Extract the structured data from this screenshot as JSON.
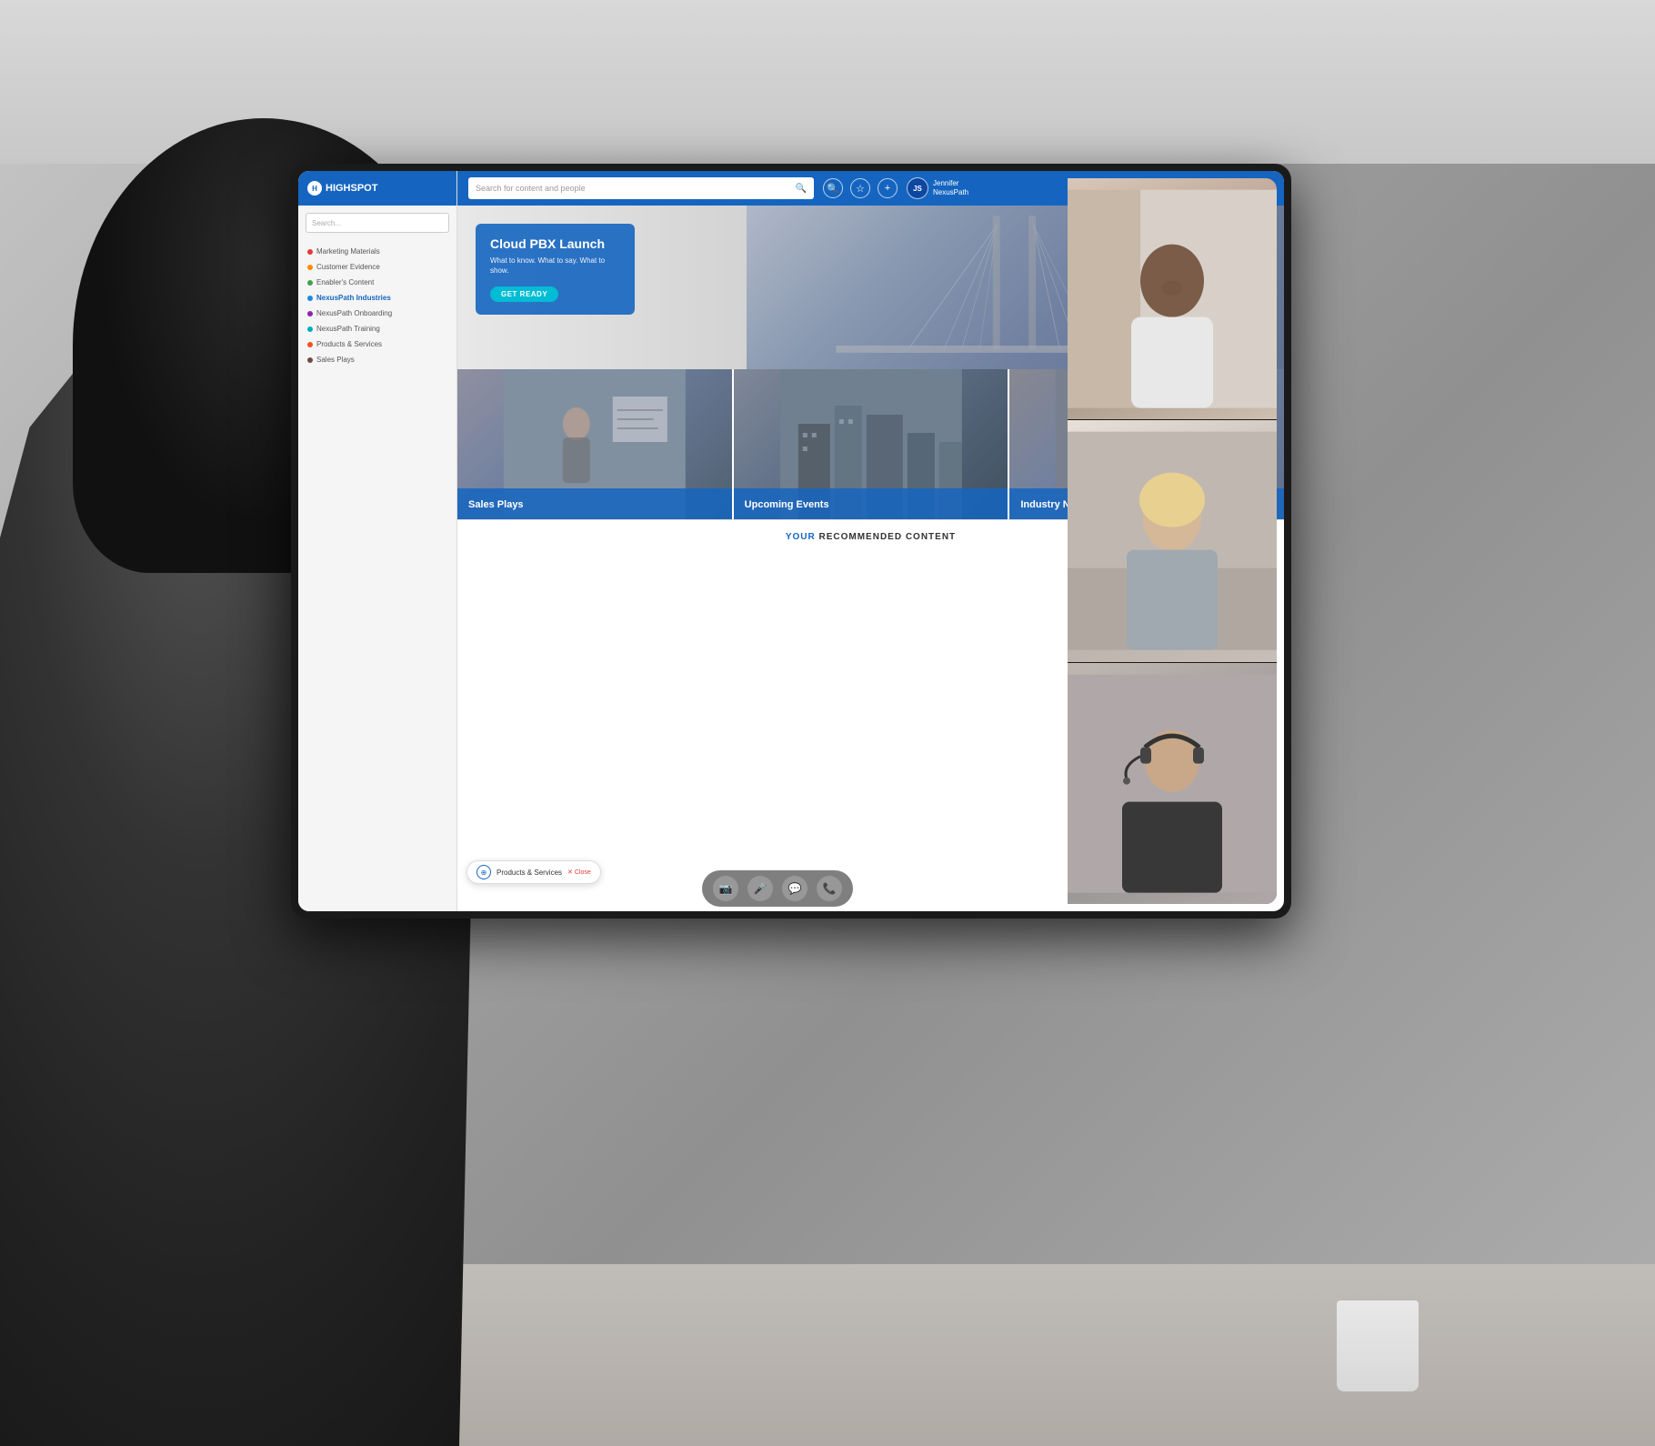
{
  "app": {
    "name": "HIGHSPOT"
  },
  "nav": {
    "search_placeholder": "Search for content and people",
    "user": {
      "initials": "JS",
      "name": "Jennifer",
      "company": "NexusPath"
    },
    "icons": {
      "search": "🔍",
      "star": "☆",
      "plus": "+"
    }
  },
  "sidebar": {
    "items": [
      {
        "label": "Marketing Materials",
        "color": "#e53935"
      },
      {
        "label": "Customer Evidence",
        "color": "#fb8c00"
      },
      {
        "label": "Enabler's Content",
        "color": "#43a047"
      },
      {
        "label": "NexusPath Industries",
        "color": "#1e88e5"
      },
      {
        "label": "NexusPath Onboarding",
        "color": "#8e24aa"
      },
      {
        "label": "NexusPath Training",
        "color": "#00acc1"
      },
      {
        "label": "Products & Services",
        "color": "#f4511e"
      },
      {
        "label": "Sales Plays",
        "color": "#6d4c41"
      }
    ]
  },
  "hero": {
    "title": "Cloud PBX Launch",
    "subtitle": "What to know. What to say. What to show.",
    "cta_label": "GET READY"
  },
  "cards": [
    {
      "label": "Sales Plays",
      "bg": "sales"
    },
    {
      "label": "Upcoming Events",
      "bg": "events"
    },
    {
      "label": "Industry News",
      "bg": "news"
    }
  ],
  "recommended": {
    "prefix": "YOUR",
    "text": " RECOMMENDED CONTENT"
  },
  "tooltip": {
    "text": "Products & Services",
    "close": "✕ Close"
  },
  "video_controls": {
    "camera": "📷",
    "mic": "🎤",
    "chat": "💬",
    "end": "📞"
  }
}
